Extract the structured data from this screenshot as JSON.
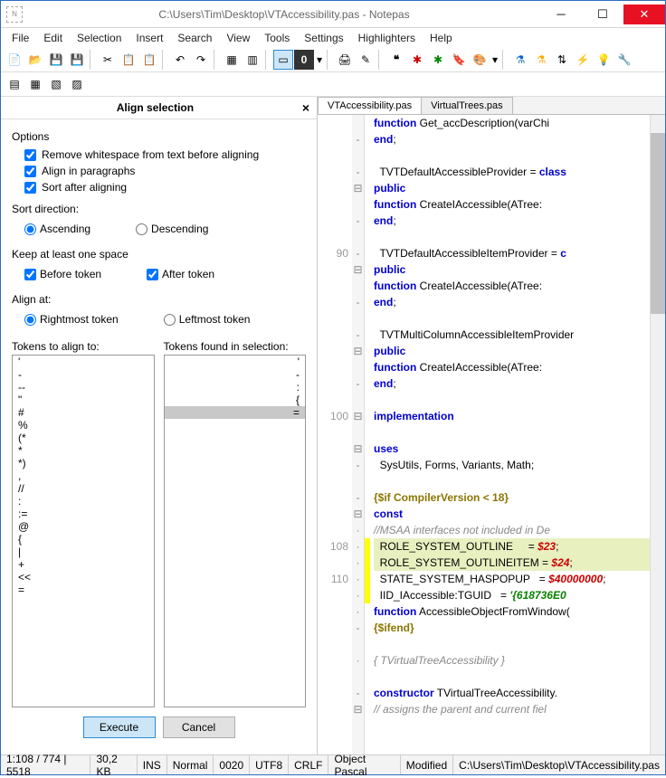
{
  "title": "C:\\Users\\Tim\\Desktop\\VTAccessibility.pas - Notepas",
  "menu": [
    "File",
    "Edit",
    "Selection",
    "Insert",
    "Search",
    "View",
    "Tools",
    "Settings",
    "Highlighters",
    "Help"
  ],
  "panel": {
    "title": "Align selection",
    "options_label": "Options",
    "opt1": "Remove whitespace from text before aligning",
    "opt2": "Align in paragraphs",
    "opt3": "Sort after aligning",
    "sortdir_label": "Sort direction:",
    "asc": "Ascending",
    "desc": "Descending",
    "keep_label": "Keep at least one space",
    "before": "Before token",
    "after": "After token",
    "alignat_label": "Align at:",
    "right": "Rightmost token",
    "left": "Leftmost token",
    "tokens_label": "Tokens to align to:",
    "found_label": "Tokens found in selection:",
    "tokens": [
      "'",
      "-",
      "--",
      "\"",
      "#",
      "%",
      "(*",
      "*",
      "*)",
      ",",
      "//",
      ":",
      ":=",
      "@",
      "{",
      "|",
      "+",
      "<<",
      "="
    ],
    "found": [
      "'",
      "-",
      ":",
      "{",
      "="
    ],
    "execute": "Execute",
    "cancel": "Cancel"
  },
  "tabs": [
    "VTAccessibility.pas",
    "VirtualTrees.pas"
  ],
  "code": {
    "lines": [
      {
        "ln": "",
        "fold": "",
        "mark": "",
        "html": "    <span class='kw'>function</span> Get_accDescription(varChi"
      },
      {
        "ln": "",
        "fold": "-",
        "mark": "",
        "html": "  <span class='kw'>end</span>;"
      },
      {
        "ln": "",
        "fold": "",
        "mark": "",
        "html": ""
      },
      {
        "ln": "",
        "fold": "-",
        "mark": "",
        "html": "  TVTDefaultAccessibleProvider = <span class='kw'>class</span>"
      },
      {
        "ln": "",
        "fold": "⊟",
        "mark": "",
        "html": "  <span class='kw'>public</span>"
      },
      {
        "ln": "",
        "fold": "",
        "mark": "",
        "html": "    <span class='kw'>function</span> CreateIAccessible(ATree:"
      },
      {
        "ln": "",
        "fold": "-",
        "mark": "",
        "html": "  <span class='kw'>end</span>;"
      },
      {
        "ln": "",
        "fold": "",
        "mark": "",
        "html": ""
      },
      {
        "ln": "90",
        "fold": "-",
        "mark": "",
        "html": "  TVTDefaultAccessibleItemProvider = <span class='kw'>c</span>"
      },
      {
        "ln": "",
        "fold": "⊟",
        "mark": "",
        "html": "  <span class='kw'>public</span>"
      },
      {
        "ln": "",
        "fold": "",
        "mark": "",
        "html": "    <span class='kw'>function</span> CreateIAccessible(ATree:"
      },
      {
        "ln": "",
        "fold": "-",
        "mark": "",
        "html": "  <span class='kw'>end</span>;"
      },
      {
        "ln": "",
        "fold": "",
        "mark": "",
        "html": ""
      },
      {
        "ln": "",
        "fold": "-",
        "mark": "",
        "html": "  TVTMultiColumnAccessibleItemProvider"
      },
      {
        "ln": "",
        "fold": "⊟",
        "mark": "",
        "html": "  <span class='kw'>public</span>"
      },
      {
        "ln": "",
        "fold": "",
        "mark": "",
        "html": "    <span class='kw'>function</span> CreateIAccessible(ATree:"
      },
      {
        "ln": "",
        "fold": "-",
        "mark": "",
        "html": "  <span class='kw'>end</span>;"
      },
      {
        "ln": "",
        "fold": "",
        "mark": "",
        "html": ""
      },
      {
        "ln": "100",
        "fold": "⊟",
        "mark": "",
        "html": "<span class='kw'>implementation</span>"
      },
      {
        "ln": "",
        "fold": "",
        "mark": "",
        "html": ""
      },
      {
        "ln": "",
        "fold": "⊟",
        "mark": "",
        "html": "<span class='kw'>uses</span>"
      },
      {
        "ln": "",
        "fold": "-",
        "mark": "",
        "html": "  SysUtils, Forms, Variants, Math;"
      },
      {
        "ln": "",
        "fold": "",
        "mark": "",
        "html": ""
      },
      {
        "ln": "",
        "fold": "-",
        "mark": "",
        "html": "<span class='dir'>{$if CompilerVersion &lt; 18}</span>"
      },
      {
        "ln": "",
        "fold": "⊟",
        "mark": "",
        "html": "<span class='kw'>const</span>"
      },
      {
        "ln": "",
        "fold": "·",
        "mark": "",
        "html": "  <span class='cm'>//MSAA interfaces not included in De</span>"
      },
      {
        "ln": "108",
        "fold": "·",
        "mark": "hlb",
        "hl": true,
        "html": "  ROLE_SYSTEM_OUTLINE     = <span class='num'>$23</span>;"
      },
      {
        "ln": "",
        "fold": "·",
        "mark": "hlb",
        "hl": true,
        "html": "  ROLE_SYSTEM_OUTLINEITEM = <span class='num'>$24</span>;"
      },
      {
        "ln": "110",
        "fold": "·",
        "mark": "hlb",
        "html": "  STATE_SYSTEM_HASPOPUP   = <span class='num'>$40000000</span>;"
      },
      {
        "ln": "",
        "fold": "·",
        "mark": "hlb",
        "html": "  IID_IAccessible:TGUID   = <span class='str'>'{618736E0</span>"
      },
      {
        "ln": "",
        "fold": "·",
        "mark": "",
        "html": "  <span class='kw'>function</span> AccessibleObjectFromWindow("
      },
      {
        "ln": "",
        "fold": "-",
        "mark": "",
        "html": "<span class='dir'>{$ifend}</span>"
      },
      {
        "ln": "",
        "fold": "",
        "mark": "",
        "html": ""
      },
      {
        "ln": "",
        "fold": "·",
        "mark": "",
        "html": "  <span class='cm'>{ TVirtualTreeAccessibility }</span>"
      },
      {
        "ln": "",
        "fold": "",
        "mark": "",
        "html": ""
      },
      {
        "ln": "",
        "fold": "-",
        "mark": "",
        "html": "<span class='kw'>constructor</span> TVirtualTreeAccessibility."
      },
      {
        "ln": "",
        "fold": "⊟",
        "mark": "",
        "html": "<span class='cm'>// assigns the parent and current fiel</span>"
      }
    ]
  },
  "status": {
    "pos": "1:108 / 774 | 5518",
    "size": "30,2 KB",
    "ins": "INS",
    "mode": "Normal",
    "cp": "0020",
    "enc": "UTF8",
    "eol": "CRLF",
    "lang": "Object Pascal",
    "mod": "Modified",
    "path": "C:\\Users\\Tim\\Desktop\\VTAccessibility.pas"
  }
}
